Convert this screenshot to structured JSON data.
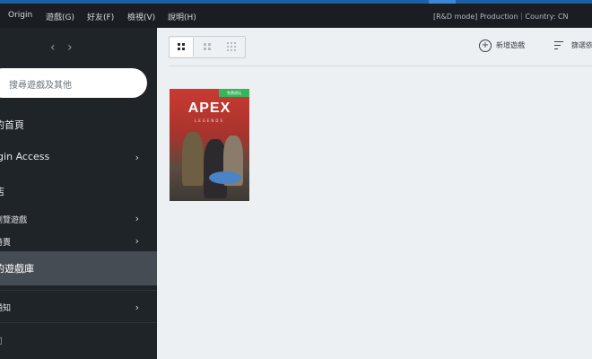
{
  "menu": {
    "items": [
      "Origin",
      "遊戲(G)",
      "好友(F)",
      "檢視(V)",
      "說明(H)"
    ],
    "mode_text": "[R&D mode] Production｜Country: CN"
  },
  "sidebar": {
    "search_placeholder": "搜尋遊戲及其他",
    "items": [
      {
        "label": "的首頁",
        "has_chevron": false,
        "active": false
      },
      {
        "label": "igin Access",
        "has_chevron": true,
        "active": false
      },
      {
        "label": "店",
        "has_chevron": false,
        "active": false
      },
      {
        "label": "瀏覽遊戲",
        "has_chevron": true,
        "active": false
      },
      {
        "label": "特賣",
        "has_chevron": true,
        "active": false
      },
      {
        "label": "的遊戲庫",
        "has_chevron": false,
        "active": true
      },
      {
        "label": "通知",
        "has_chevron": true,
        "active": false
      },
      {
        "label": "司",
        "has_chevron": false,
        "active": false
      }
    ],
    "chevron": "›",
    "nav_back": "‹",
    "nav_forward": "›"
  },
  "toolbar": {
    "add_game_label": "新增遊戲",
    "filter_label": "篩選依"
  },
  "games": [
    {
      "title": "APEX",
      "subtitle": "LEGENDS",
      "badge": "免費遊玩"
    }
  ],
  "colors": {
    "accent": "#3b87d6",
    "sidebar_bg": "#1f2429",
    "active_item_bg": "#464c53",
    "main_bg": "#edf0f2",
    "badge_green": "#38b55a"
  }
}
